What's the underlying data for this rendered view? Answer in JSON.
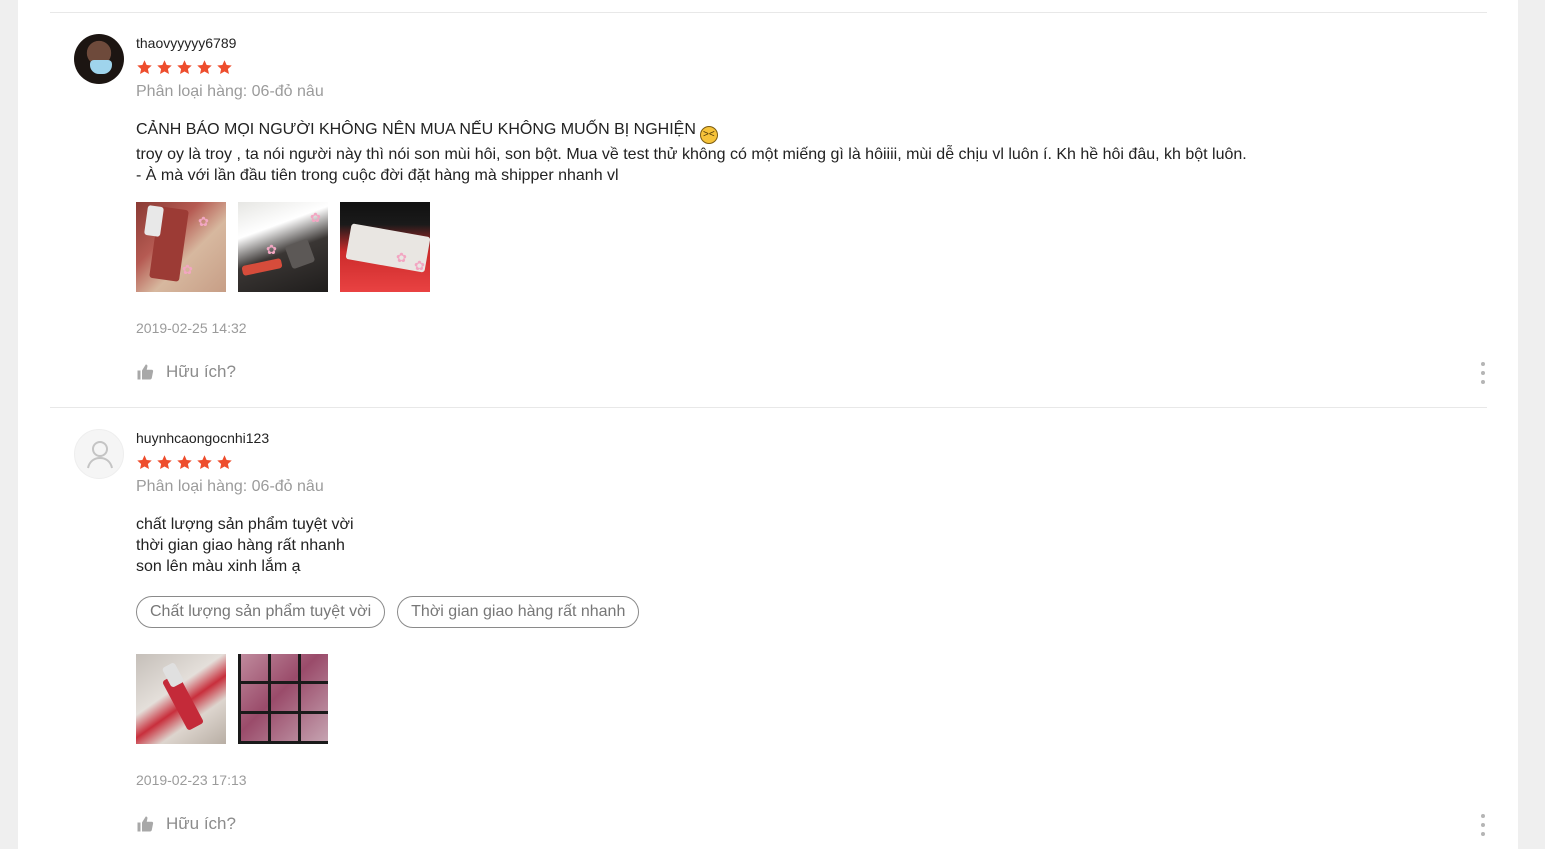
{
  "colors": {
    "star": "#ee4d2d",
    "muted_text": "#9b9b9b",
    "body_text": "#222222"
  },
  "reviews": [
    {
      "username": "thaovyyyyy6789",
      "rating": 5,
      "variation": "Phân loại hàng: 06-đỏ nâu",
      "comment_lines": [
        "CẢNH BÁO MỌI NGƯỜI KHÔNG NÊN MUA NẾU KHÔNG MUỐN BỊ NGHIỆN",
        "troy oy là troy , ta nói người này thì nói son mùi hôi, son bột. Mua về test thử không có một miếng gì là hôiiii, mùi dễ chịu vl luôn í. Kh hề hôi đâu, kh bột luôn.",
        "- À mà với lần đầu tiên trong cuộc đời đặt hàng mà shipper nhanh vl"
      ],
      "emoji": "tired-face-emoji",
      "tags": [],
      "photo_count": 3,
      "date": "2019-02-25 14:32",
      "helpful_label": "Hữu ích?"
    },
    {
      "username": "huynhcaongocnhi123",
      "rating": 5,
      "variation": "Phân loại hàng: 06-đỏ nâu",
      "comment_lines": [
        "chất lượng sản phẩm tuyệt vời",
        "thời gian giao hàng rất nhanh",
        "son lên màu xinh lắm ạ"
      ],
      "tags": [
        "Chất lượng sản phẩm tuyệt vời",
        "Thời gian giao hàng rất nhanh"
      ],
      "photo_count": 2,
      "date": "2019-02-23 17:13",
      "helpful_label": "Hữu ích?"
    }
  ]
}
